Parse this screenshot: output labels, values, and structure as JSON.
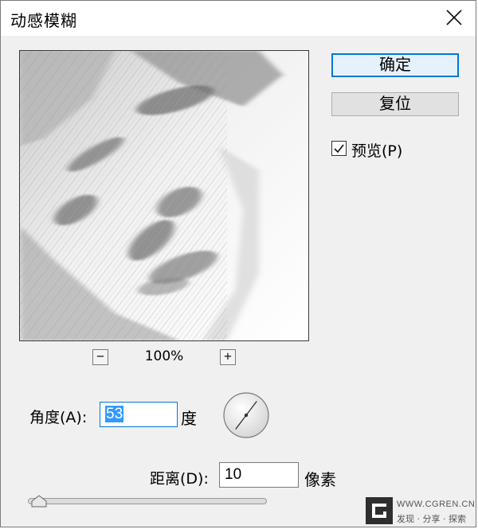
{
  "dialog": {
    "title": "动感模糊"
  },
  "buttons": {
    "ok_label": "确定",
    "reset_label": "复位"
  },
  "preview_toggle": {
    "label": "预览(P)",
    "checked": true
  },
  "zoom": {
    "level": "100%",
    "zoom_out_symbol": "−",
    "zoom_in_symbol": "+"
  },
  "angle": {
    "label": "角度(A):",
    "value": "53",
    "unit": "度",
    "degrees": 53
  },
  "distance": {
    "label": "距离(D):",
    "value": "10",
    "unit": "像素",
    "slider_fraction": 0.01
  },
  "watermark": {
    "site": "WWW.CGREN.CN",
    "slogan": "发现 · 分享 · 探索"
  },
  "colors": {
    "accent": "#0078d7",
    "selection": "#3399ff",
    "dialog_bg": "#f0f0f0"
  },
  "icons": [
    "close-icon",
    "checkmark-icon",
    "zoom-out-icon",
    "zoom-in-icon",
    "angle-dial-icon",
    "slider-thumb-icon"
  ]
}
